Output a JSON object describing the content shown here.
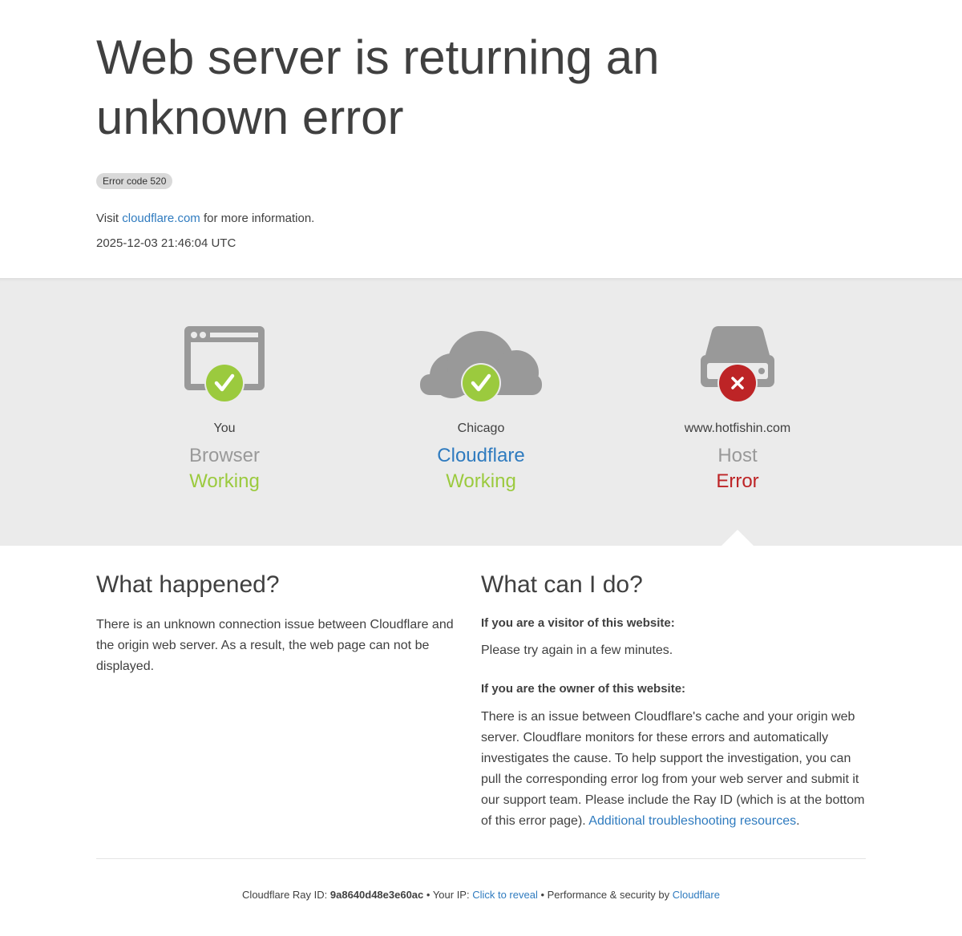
{
  "page": {
    "title": "Web server is returning an unknown error",
    "error_code_label": "Error code 520",
    "visit_prefix": "Visit ",
    "visit_link": "cloudflare.com",
    "visit_suffix": " for more information.",
    "timestamp": "2025-12-03 21:46:04 UTC"
  },
  "status": [
    {
      "location": "You",
      "role": "Browser",
      "state": "Working",
      "icon": "browser-icon",
      "badge": "check-icon"
    },
    {
      "location": "Chicago",
      "role": "Cloudflare",
      "state": "Working",
      "icon": "cloud-icon",
      "badge": "check-icon"
    },
    {
      "location": "www.hotfishin.com",
      "role": "Host",
      "state": "Error",
      "icon": "server-icon",
      "badge": "x-icon"
    }
  ],
  "colors": {
    "working": "#9bca3e",
    "error": "#bd2426",
    "link": "#2f7bbf",
    "icon_gray": "#999999"
  },
  "what_happened": {
    "heading": "What happened?",
    "body": "There is an unknown connection issue between Cloudflare and the origin web server. As a result, the web page can not be displayed."
  },
  "what_can_i_do": {
    "heading": "What can I do?",
    "visitor_heading": "If you are a visitor of this website:",
    "visitor_body": "Please try again in a few minutes.",
    "owner_heading": "If you are the owner of this website:",
    "owner_body": "There is an issue between Cloudflare's cache and your origin web server. Cloudflare monitors for these errors and automatically investigates the cause. To help support the investigation, you can pull the corresponding error log from your web server and submit it our support team. Please include the Ray ID (which is at the bottom of this error page). ",
    "owner_link": "Additional troubleshooting resources",
    "owner_end": "."
  },
  "footer": {
    "ray_label": "Cloudflare Ray ID: ",
    "ray_id": "9a8640d48e3e60ac",
    "sep1": " • ",
    "ip_label": "Your IP: ",
    "ip_link": "Click to reveal",
    "sep2": " • ",
    "perf_label": "Performance & security by ",
    "perf_link": "Cloudflare"
  }
}
